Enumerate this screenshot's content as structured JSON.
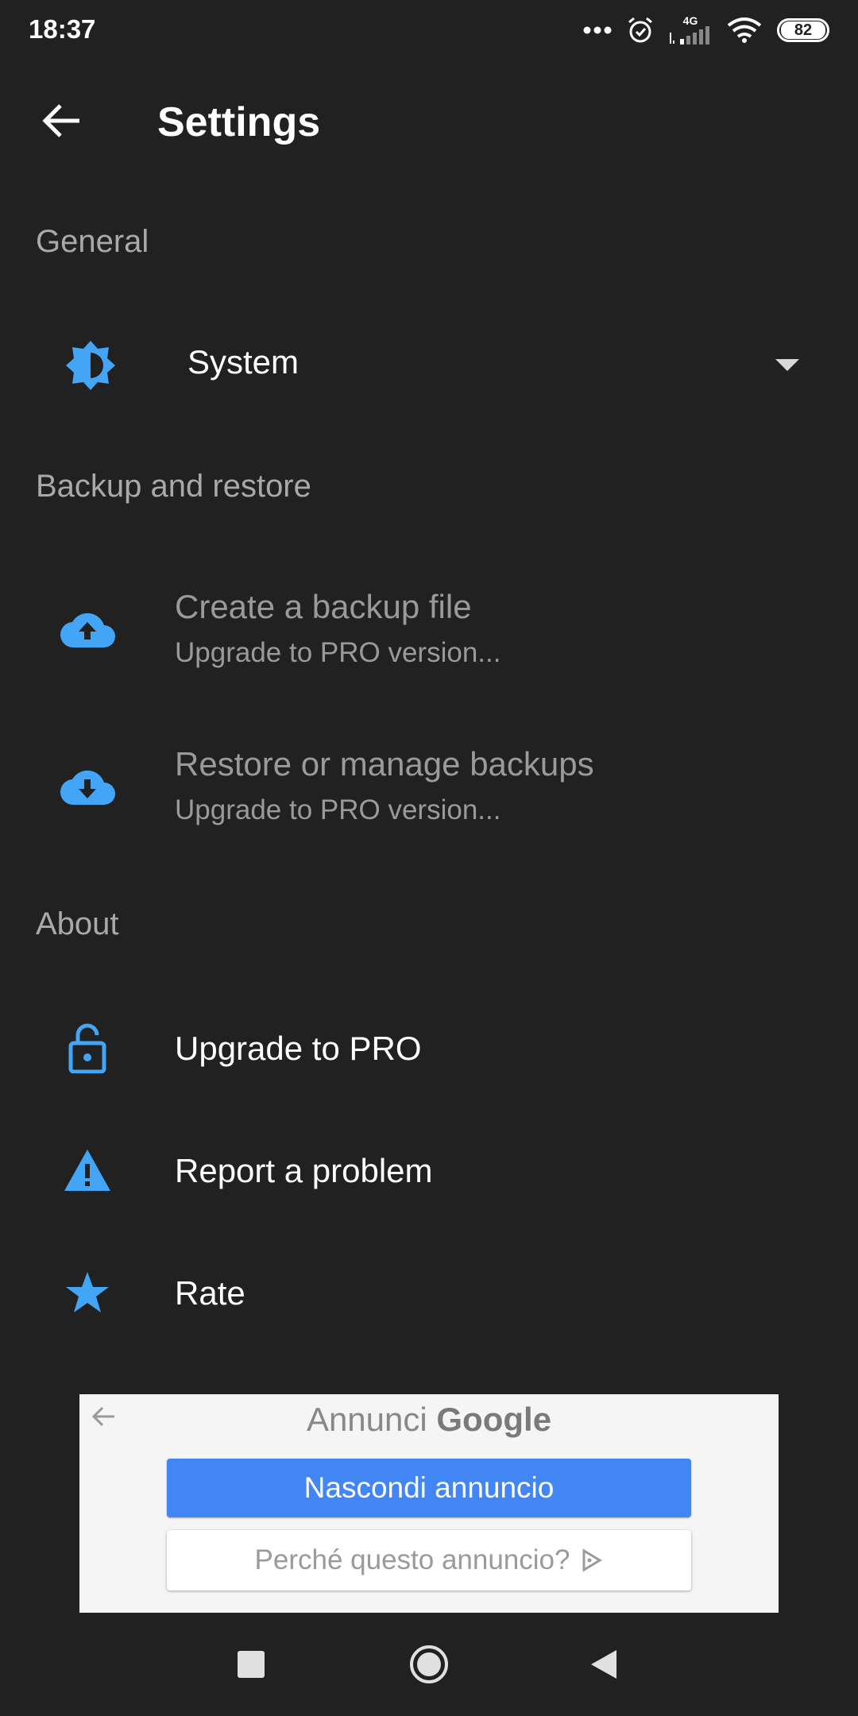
{
  "status_bar": {
    "time": "18:37",
    "network": "4G",
    "battery": "82",
    "icons": [
      "more-dots-icon",
      "alarm-icon",
      "signal-icon",
      "wifi-icon",
      "battery-icon"
    ]
  },
  "toolbar": {
    "title": "Settings",
    "back_icon": "arrow-back-icon"
  },
  "sections": {
    "general": "General",
    "backup": "Backup and restore",
    "about": "About"
  },
  "theme": {
    "value": "System",
    "icon": "brightness-auto-icon"
  },
  "backup_items": [
    {
      "title": "Create a backup file",
      "subtitle": "Upgrade to PRO version...",
      "icon": "cloud-upload-icon"
    },
    {
      "title": "Restore or manage backups",
      "subtitle": "Upgrade to PRO version...",
      "icon": "cloud-download-icon"
    }
  ],
  "about_items": [
    {
      "title": "Upgrade to PRO",
      "icon": "lock-open-icon"
    },
    {
      "title": "Report a problem",
      "icon": "warning-icon"
    },
    {
      "title": "Rate",
      "icon": "star-icon"
    }
  ],
  "ad": {
    "label_prefix": "Annunci",
    "label_brand": "Google",
    "hide_button": "Nascondi annuncio",
    "why_button": "Perché questo annuncio?"
  },
  "colors": {
    "background": "#212121",
    "accent": "#42a5f5",
    "ad_button": "#4285f4"
  }
}
